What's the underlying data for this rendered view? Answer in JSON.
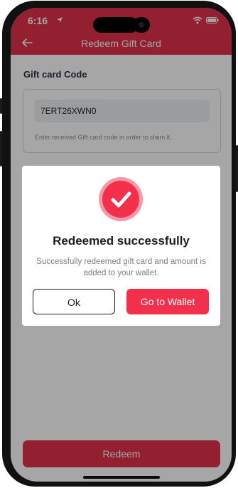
{
  "status_bar": {
    "time": "6:16",
    "icons": [
      "location-arrow-icon",
      "wifi-icon",
      "battery-icon"
    ]
  },
  "header": {
    "title": "Redeem Gift Card",
    "back_icon": "back-arrow-icon"
  },
  "form": {
    "section_label": "Gift card Code",
    "code_value": "7ERT26XWN0",
    "hint": "Enter received Gift card code in order to claim it.",
    "redeem_label": "Redeem"
  },
  "dialog": {
    "icon": "checkmark-icon",
    "title": "Redeemed successfully",
    "message": "Successfully redeemed gift card and amount is added to your wallet.",
    "ok_label": "Ok",
    "wallet_label": "Go to Wallet"
  },
  "colors": {
    "brand": "#e0324a",
    "accent": "#f2304c",
    "overlay": "rgba(0,0,0,0.35)",
    "text_dark": "#1d1d1f",
    "text_muted": "#7b7e86"
  }
}
